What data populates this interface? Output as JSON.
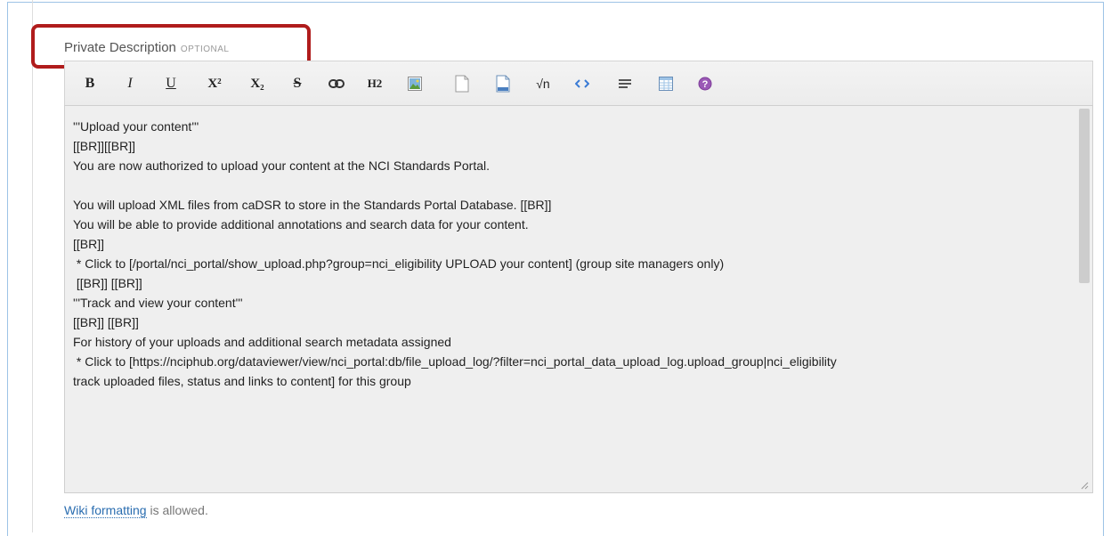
{
  "field": {
    "label": "Private Description",
    "optional_tag": "OPTIONAL"
  },
  "toolbar": {
    "buttons": [
      {
        "name": "bold-button",
        "glyph": "B"
      },
      {
        "name": "italic-button",
        "glyph": "I"
      },
      {
        "name": "underline-button",
        "glyph": "U"
      },
      {
        "name": "superscript-button",
        "glyph": "X²"
      },
      {
        "name": "subscript-button",
        "glyph": "X₂"
      },
      {
        "name": "strikethrough-button",
        "glyph": "S"
      },
      {
        "name": "link-button",
        "glyph": "link-icon"
      },
      {
        "name": "heading-button",
        "glyph": "H2"
      },
      {
        "name": "image-button",
        "glyph": "image-icon"
      },
      {
        "name": "file-button",
        "glyph": "file-icon"
      },
      {
        "name": "document-button",
        "glyph": "document-icon"
      },
      {
        "name": "math-button",
        "glyph": "√n"
      },
      {
        "name": "code-button",
        "glyph": "code-icon"
      },
      {
        "name": "horizontal-rule-button",
        "glyph": "hr-icon"
      },
      {
        "name": "table-button",
        "glyph": "table-icon"
      },
      {
        "name": "help-button",
        "glyph": "help-icon"
      }
    ]
  },
  "editor": {
    "content": "'''Upload your content'''\n[[BR]][[BR]]\nYou are now authorized to upload your content at the NCI Standards Portal.\n\nYou will upload XML files from caDSR to store in the Standards Portal Database. [[BR]]\nYou will be able to provide additional annotations and search data for your content.\n[[BR]]\n * Click to [/portal/nci_portal/show_upload.php?group=nci_eligibility UPLOAD your content] (group site managers only)\n [[BR]] [[BR]]\n'''Track and view your content'''\n[[BR]] [[BR]]\nFor history of your uploads and additional search metadata assigned\n * Click to [https://nciphub.org/dataviewer/view/nci_portal:db/file_upload_log/?filter=nci_portal_data_upload_log.upload_group|nci_eligibility\ntrack uploaded files, status and links to content] for this group"
  },
  "hint": {
    "link_text": "Wiki formatting",
    "suffix": " is allowed."
  },
  "colors": {
    "highlight_border": "#b01c1c",
    "frame_border": "#9dc3e6",
    "editor_bg": "#efefef",
    "link": "#2a6db0"
  }
}
